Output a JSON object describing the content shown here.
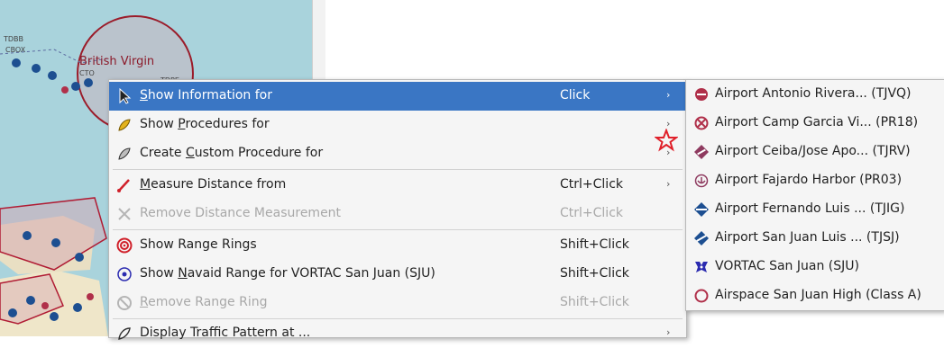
{
  "map": {
    "label": "British Virgin",
    "labels_small": [
      "TDBB",
      "CBOX",
      "TDPE",
      "CTO"
    ]
  },
  "menu": {
    "items": [
      {
        "key": "show-information",
        "pre": "",
        "ul": "S",
        "post": "how Information for",
        "shortcut": "Click",
        "arrow": "›",
        "icon": "cursor-icon"
      },
      {
        "key": "show-procedures",
        "pre": "Show ",
        "ul": "P",
        "post": "rocedures for",
        "shortcut": "",
        "arrow": "›",
        "icon": "procedure-icon"
      },
      {
        "key": "create-custom-procedure",
        "pre": "Create ",
        "ul": "C",
        "post": "ustom Procedure for",
        "shortcut": "",
        "arrow": "›",
        "icon": "custom-procedure-icon"
      },
      {
        "key": "measure-distance",
        "pre": "",
        "ul": "M",
        "post": "easure Distance from",
        "shortcut": "Ctrl+Click",
        "arrow": "›",
        "icon": "measure-icon"
      },
      {
        "key": "remove-distance",
        "pre": "Remove Distance Measurement",
        "ul": "",
        "post": "",
        "shortcut": "Ctrl+Click",
        "arrow": "",
        "icon": "remove-measure-icon"
      },
      {
        "key": "show-range-rings",
        "pre": "Show ",
        "ul": "",
        "post": "Range Rings",
        "shortcut": "Shift+Click",
        "arrow": "",
        "icon": "range-rings-icon"
      },
      {
        "key": "show-navaid-range",
        "pre": "Show ",
        "ul": "N",
        "post": "avaid Range for VORTAC San Juan (SJU)",
        "shortcut": "Shift+Click",
        "arrow": "",
        "icon": "navaid-range-icon"
      },
      {
        "key": "remove-range-ring",
        "pre": "",
        "ul": "R",
        "post": "emove Range Ring",
        "shortcut": "Shift+Click",
        "arrow": "",
        "icon": "remove-range-icon"
      },
      {
        "key": "display-traffic-pattern",
        "pre": "Display Traffic Pattern at ...",
        "ul": "",
        "post": "",
        "shortcut": "",
        "arrow": "›",
        "icon": "traffic-pattern-icon"
      }
    ]
  },
  "submenu": {
    "items": [
      {
        "label": "Airport Antonio Rivera... (TJVQ)",
        "icon": "airport-closed-icon"
      },
      {
        "label": "Airport Camp Garcia Vi... (PR18)",
        "icon": "airport-military-icon"
      },
      {
        "label": "Airport Ceiba/Jose Apo... (TJRV)",
        "icon": "airport-diamond-icon"
      },
      {
        "label": "Airport Fajardo Harbor (PR03)",
        "icon": "seaplane-base-icon"
      },
      {
        "label": "Airport Fernando Luis ... (TJIG)",
        "icon": "airport-diamond-icon"
      },
      {
        "label": "Airport San Juan Luis ... (TJSJ)",
        "icon": "airport-diamond-icon"
      },
      {
        "label": "VORTAC San Juan (SJU)",
        "icon": "vortac-icon"
      },
      {
        "label": "Airspace San Juan High (Class A)",
        "icon": "airspace-icon"
      }
    ]
  },
  "colors": {
    "highlight": "#3a76c4",
    "airport_red": "#b0304a",
    "airport_blue": "#1d4f91",
    "vortac": "#2b2bb0",
    "star": "#e0202a"
  }
}
